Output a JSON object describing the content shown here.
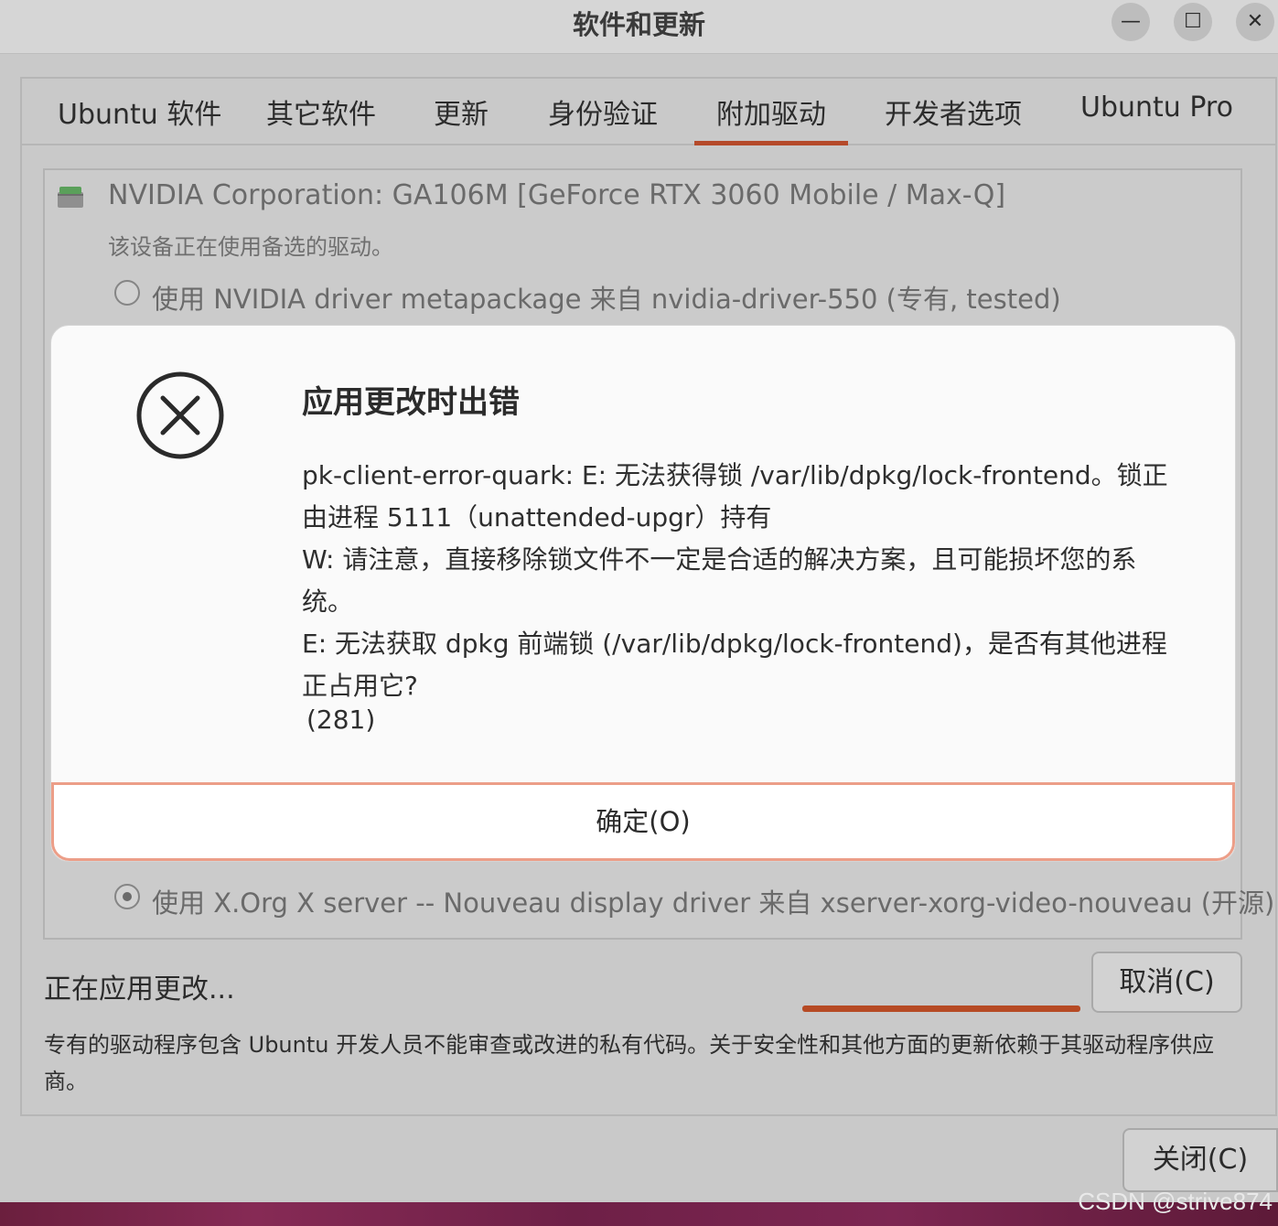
{
  "window": {
    "title": "软件和更新",
    "minimize_glyph": "—",
    "maximize_glyph": "☐",
    "close_glyph": "✕"
  },
  "tabs": [
    {
      "label": "Ubuntu 软件"
    },
    {
      "label": "其它软件"
    },
    {
      "label": "更新"
    },
    {
      "label": "身份验证"
    },
    {
      "label": "附加驱动",
      "active": true
    },
    {
      "label": "开发者选项"
    },
    {
      "label": "Ubuntu Pro"
    }
  ],
  "device": {
    "name": "NVIDIA Corporation: GA106M [GeForce RTX 3060 Mobile / Max-Q]",
    "status": "该设备正在使用备选的驱动。",
    "options": [
      {
        "label": "使用 NVIDIA driver metapackage 来自 nvidia-driver-550 (专有, tested)",
        "selected": false
      },
      {
        "label": "使用 X.Org X server -- Nouveau display driver 来自 xserver-xorg-video-nouveau (开源)",
        "selected": true
      }
    ]
  },
  "dialog": {
    "title": "应用更改时出错",
    "message_lines": [
      "pk-client-error-quark: E: 无法获得锁 /var/lib/dpkg/lock-frontend。锁正由进程 5111（unattended-upgr）持有",
      "W: 请注意，直接移除锁文件不一定是合适的解决方案，且可能损坏您的系统。",
      "E: 无法获取 dpkg 前端锁 (/var/lib/dpkg/lock-frontend)，是否有其他进程正占用它?"
    ],
    "code": "(281)",
    "ok_label": "确定(O)"
  },
  "status": {
    "applying_text": "正在应用更改...",
    "cancel_label": "取消(C)"
  },
  "footer_note": "专有的驱动程序包含 Ubuntu 开发人员不能审查或改进的私有代码。关于安全性和其他方面的更新依赖于其驱动程序供应商。",
  "close_label": "关闭(C)",
  "watermark": "CSDN @strive874",
  "colors": {
    "accent": "#b54a2a",
    "dialog_bg": "#fafafa",
    "window_bg": "#c9c9c9"
  }
}
